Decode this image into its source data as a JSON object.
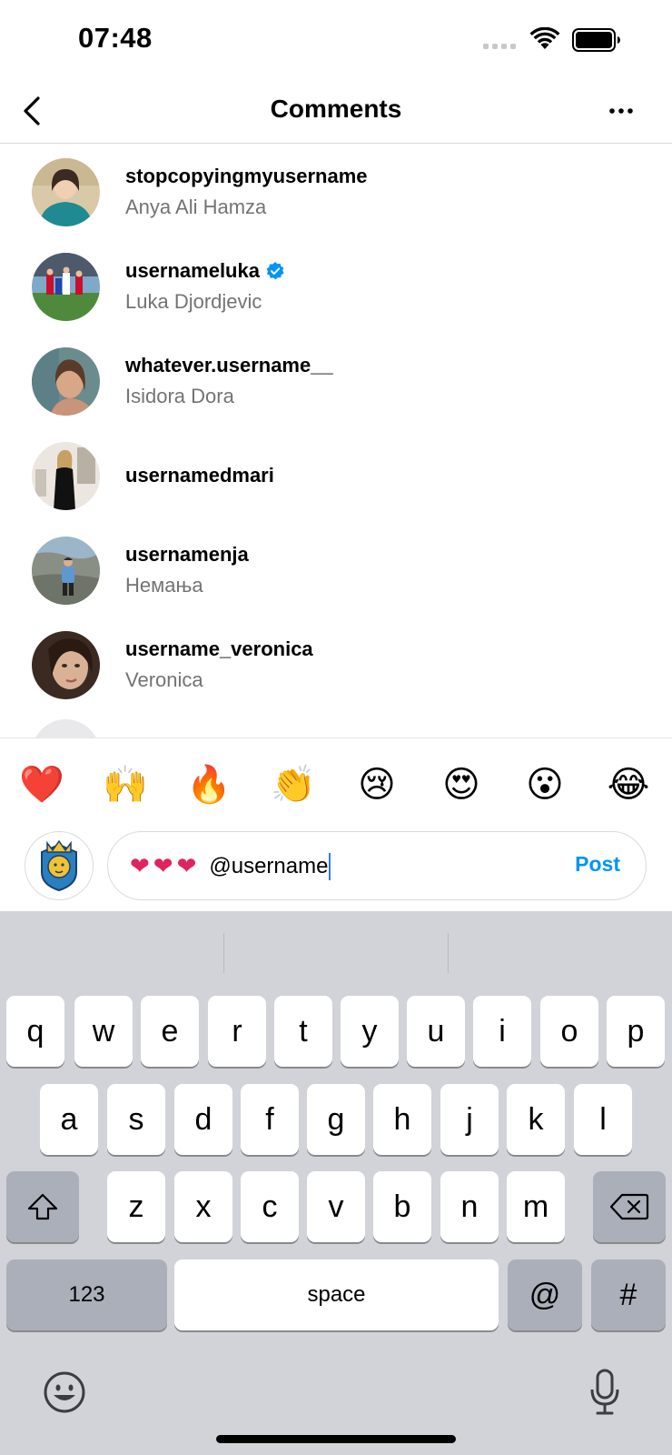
{
  "status_bar": {
    "time": "07:48"
  },
  "header": {
    "title": "Comments"
  },
  "users": [
    {
      "username": "stopcopyingmyusername",
      "name": "Anya Ali Hamza",
      "verified": false
    },
    {
      "username": "usernameluka",
      "name": "Luka Djordjevic",
      "verified": true
    },
    {
      "username": "whatever.username__",
      "name": "Isidora Dora",
      "verified": false
    },
    {
      "username": "usernamedmari",
      "name": "",
      "verified": false
    },
    {
      "username": "usernamenja",
      "name": "Немања",
      "verified": false
    },
    {
      "username": "username_veronica",
      "name": "Veronica",
      "verified": false
    }
  ],
  "emoji_bar": [
    "❤️",
    "🙌",
    "🔥",
    "👏",
    "😢",
    "😍",
    "😮",
    "😂"
  ],
  "composer": {
    "hearts": "❤❤❤",
    "text": "@username",
    "post_label": "Post"
  },
  "keyboard": {
    "row1": [
      "q",
      "w",
      "e",
      "r",
      "t",
      "y",
      "u",
      "i",
      "o",
      "p"
    ],
    "row2": [
      "a",
      "s",
      "d",
      "f",
      "g",
      "h",
      "j",
      "k",
      "l"
    ],
    "row3": [
      "z",
      "x",
      "c",
      "v",
      "b",
      "n",
      "m"
    ],
    "numbers_label": "123",
    "space_label": "space",
    "at_label": "@",
    "hash_label": "#"
  }
}
